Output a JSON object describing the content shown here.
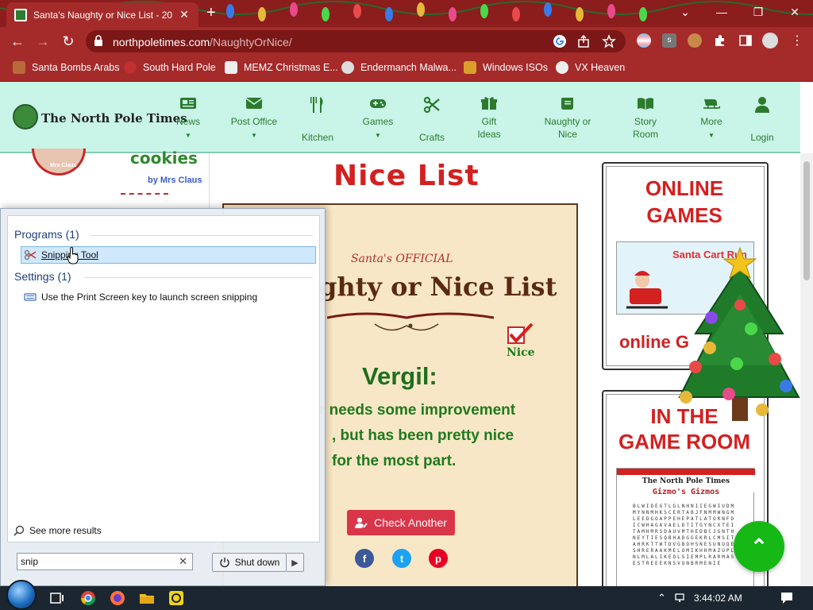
{
  "browser": {
    "tab_title": "Santa's Naughty or Nice List - 20",
    "tab_close": "✕",
    "new_tab": "+",
    "url_host": "northpoletimes.com",
    "url_path": "/NaughtyOrNice/",
    "window_controls": [
      "⌄",
      "—",
      "❐",
      "✕"
    ],
    "bookmarks": [
      "Santa Bombs Arabs",
      "South Hard Pole",
      "MEMZ Christmas E...",
      "Endermanch Malwa...",
      "Windows ISOs",
      "VX Heaven"
    ]
  },
  "site": {
    "logo_text": "The North Pole Times",
    "nav": [
      {
        "line1": "News",
        "line2": ""
      },
      {
        "line1": "Post Office",
        "line2": ""
      },
      {
        "line1": "",
        "line2": "Kitchen"
      },
      {
        "line1": "Games",
        "line2": ""
      },
      {
        "line1": "",
        "line2": "Crafts"
      },
      {
        "line1": "Gift",
        "line2": "Ideas"
      },
      {
        "line1": "Naughty or",
        "line2": "Nice"
      },
      {
        "line1": "Story",
        "line2": "Room"
      },
      {
        "line1": "More",
        "line2": ""
      },
      {
        "line1": "",
        "line2": "Login"
      }
    ],
    "left": {
      "title": "cookies",
      "byline": "by Mrs Claus",
      "avatar_caption": "Mrs Claus"
    },
    "page_title": "Nice List",
    "certificate": {
      "official": "Santa's OFFICIAL",
      "heading": "ghty or Nice List",
      "stamp_label": "Nice",
      "name": "Vergil:",
      "message_lines": [
        "r needs some improvement",
        ", but has been pretty nice",
        "for the most part."
      ],
      "button_label": "Check Another",
      "social": [
        "f",
        "t",
        "p"
      ]
    },
    "sidebar": {
      "box1_title_1": "ONLINE",
      "box1_title_2": "GAMES",
      "game_thumb_title": "Santa Cart Run",
      "box1_footer": "online G",
      "box2_title_1": "IN THE",
      "box2_title_2": "GAME ROOM",
      "puzzle_title": "The North Pole Times",
      "puzzle_subtitle": "Gizmo's Gizmos",
      "puzzle_grid": "BLWIDEGTLGLNHNIIEGWIUDMMYNNMHKSCERTABJFNMMWNGMLEEDGOAPPEHEPATLATORNFDICWHAGAVAELDTITGYNCXTEITAMHMRSDAUVMTHEDBCJGNTHNEYTIESQBHADGGEKRLCMSITAHRKTTWTDVGBOHSNESUNUQESHRERAAKMELOMIKHHMAZUPLNLMLALIKEOLSIEMPLRARMASESTREEEKNSVONBRMENIE"
    },
    "fab": "⌃"
  },
  "startmenu": {
    "programs_header": "Programs (1)",
    "program_item": "Snipping Tool",
    "settings_header": "Settings (1)",
    "settings_item": "Use the Print Screen key to launch screen snipping",
    "see_more": "See more results",
    "search_value": "snip",
    "search_clear": "✕",
    "shutdown_label": "Shut down",
    "shutdown_arrow": "▶"
  },
  "taskbar": {
    "clock": "3:44:02 AM"
  },
  "colors": {
    "chrome_red": "#a52a2a",
    "site_mint": "#c8f5e8",
    "site_green": "#2d7a2d",
    "nice_red": "#d32020",
    "cert_paper": "#f8e7c6",
    "fab_green": "#16b816"
  }
}
